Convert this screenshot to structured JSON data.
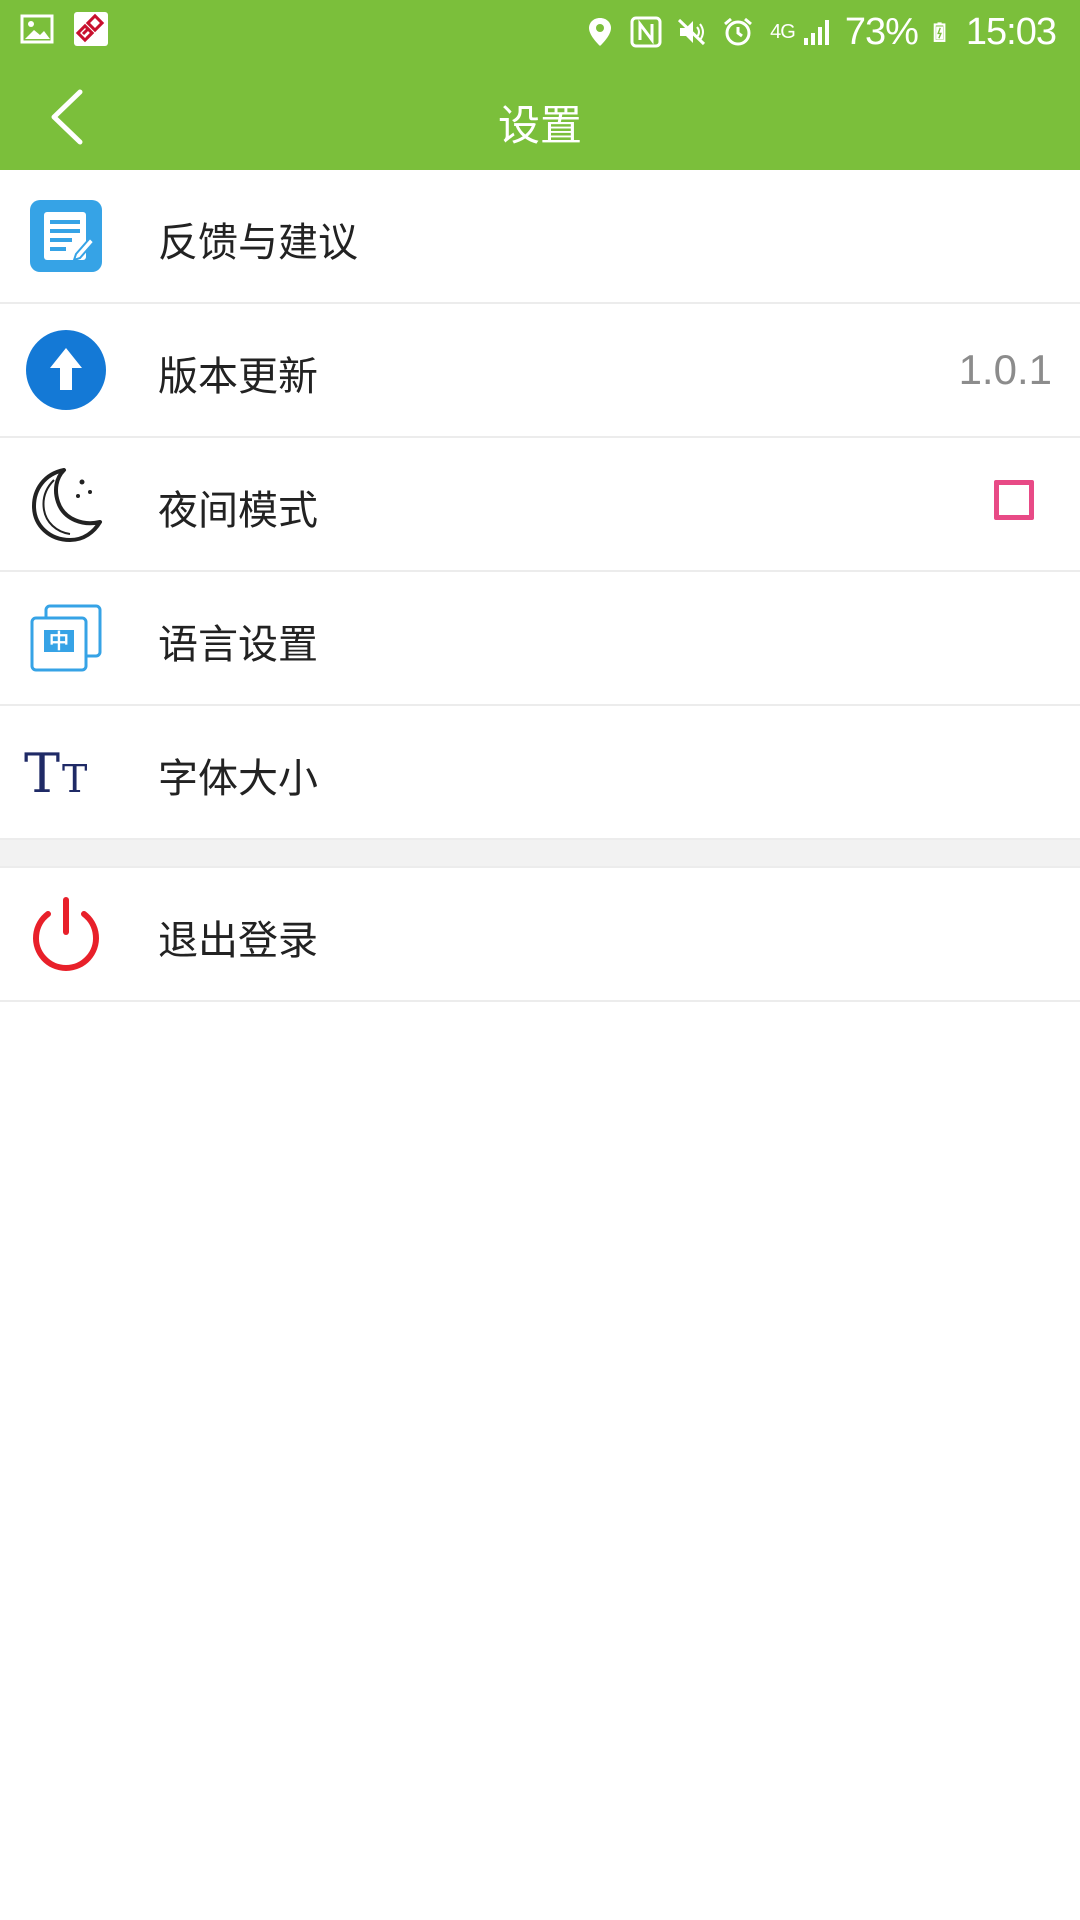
{
  "status_bar": {
    "battery": "73%",
    "time": "15:03",
    "network": "4G",
    "left_icons": [
      "gallery-icon",
      "app-notification-icon"
    ],
    "right_icons": [
      "location-icon",
      "nfc-icon",
      "mute-icon",
      "alarm-icon",
      "signal-icon",
      "battery-icon"
    ]
  },
  "header": {
    "title": "设置",
    "back_icon": "chevron-left-icon",
    "background": "#7bbf3b"
  },
  "settings": {
    "items": [
      {
        "label": "反馈与建议",
        "icon": "feedback-icon"
      },
      {
        "label": "版本更新",
        "icon": "update-arrow-icon",
        "value": "1.0.1"
      },
      {
        "label": "夜间模式",
        "icon": "moon-icon",
        "checked": false
      },
      {
        "label": "语言设置",
        "icon": "language-icon",
        "icon_text": "中"
      },
      {
        "label": "字体大小",
        "icon": "font-size-icon",
        "icon_text": "TT"
      }
    ],
    "logout": {
      "label": "退出登录",
      "icon": "power-icon"
    }
  },
  "colors": {
    "accent_green": "#7bbf3b",
    "checkbox_pink": "#e84a86",
    "update_blue": "#1479d6",
    "logout_red": "#e8202a"
  }
}
